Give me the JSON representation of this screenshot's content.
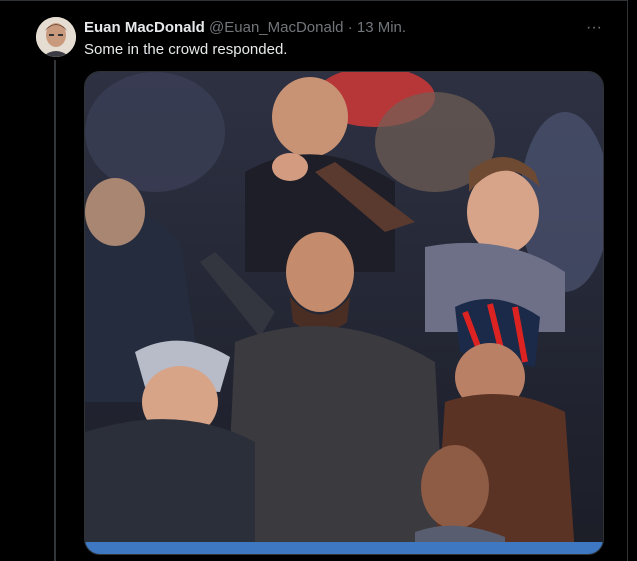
{
  "tweet": {
    "author_name": "Euan MacDonald",
    "author_handle": "@Euan_MacDonald",
    "separator": "·",
    "time": "13 Min.",
    "more_label": "···",
    "text": "Some in the crowd responded."
  },
  "media": {
    "type": "video-frame",
    "description_icon": "crowd-photo"
  },
  "colors": {
    "background": "#000000",
    "text_primary": "#e7e9ea",
    "text_secondary": "#71767b",
    "divider": "#2f3336"
  }
}
